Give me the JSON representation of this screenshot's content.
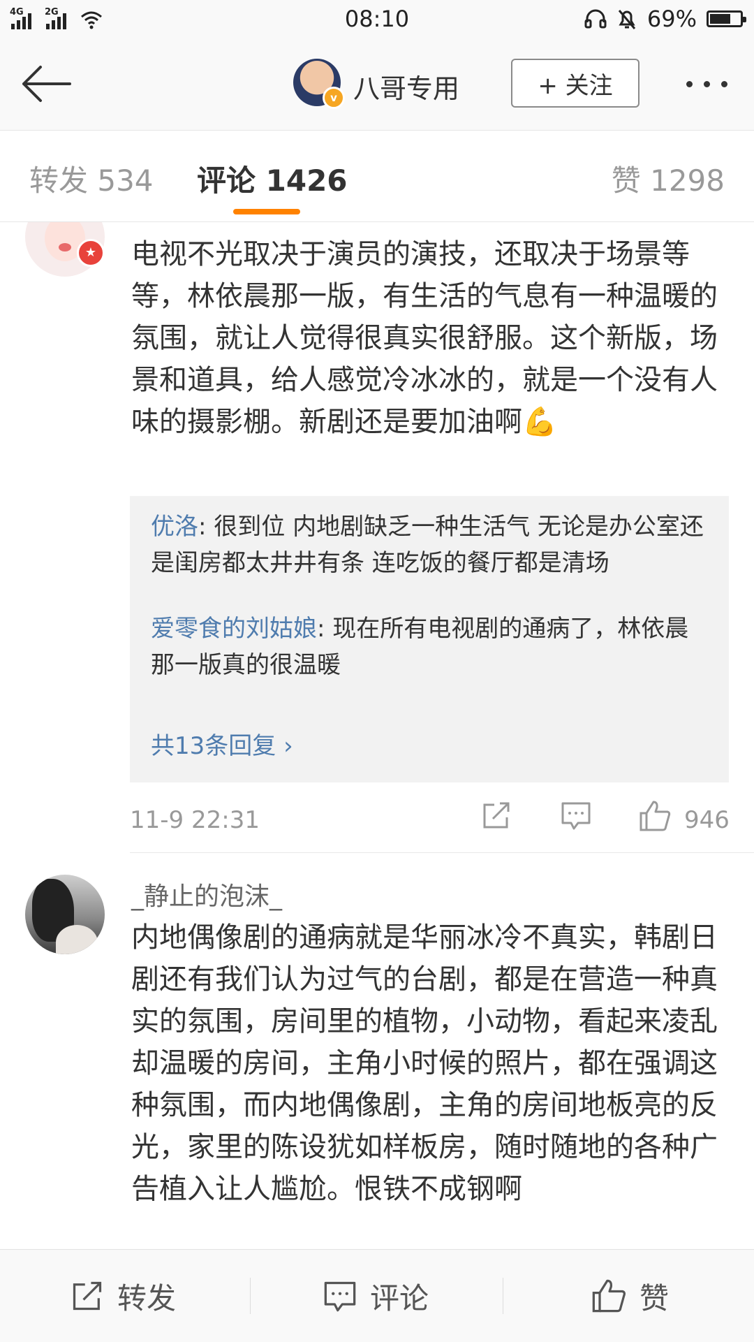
{
  "status_bar": {
    "network_1": "4G",
    "network_2": "2G",
    "time": "08:10",
    "battery_percent": "69%",
    "battery_level": 0.69
  },
  "nav": {
    "title": "八哥专用",
    "follow_label": "+ 关注",
    "icons": [
      "back-arrow-icon",
      "verified-v-icon",
      "more-dots-icon"
    ]
  },
  "tabs": {
    "repost": "转发 534",
    "comments": "评论 1426",
    "likes": "赞 1298"
  },
  "comment1": {
    "text": "电视不光取决于演员的演技，还取决于场景等等，林依晨那一版，有生活的气息有一种温暖的氛围，就让人觉得很真实很舒服。这个新版，场景和道具，给人感觉冷冰冰的，就是一个没有人味的摄影棚。新剧还是要加油啊💪",
    "replies": [
      {
        "user": "优洛",
        "text": ": 很到位 内地剧缺乏一种生活气 无论是办公室还是闺房都太井井有条 连吃饭的餐厅都是清场"
      },
      {
        "user": "爱零食的刘姑娘",
        "text": ": 现在所有电视剧的通病了，林依晨那一版真的很温暖"
      }
    ],
    "more_replies": "共13条回复 ›",
    "time": "11-9 22:31",
    "like_count": "946"
  },
  "comment2": {
    "username": "_静止的泡沫_",
    "text": "内地偶像剧的通病就是华丽冰冷不真实，韩剧日剧还有我们认为过气的台剧，都是在营造一种真实的氛围，房间里的植物，小动物，看起来凌乱却温暖的房间，主角小时候的照片，都在强调这种氛围，而内地偶像剧，主角的房间地板亮的反光，家里的陈设犹如样板房，随时随地的各种广告植入让人尴尬。恨铁不成钢啊"
  },
  "bottom_bar": {
    "repost": "转发",
    "comment": "评论",
    "like": "赞"
  },
  "colors": {
    "accent": "#ff8200",
    "link": "#4f7cae",
    "muted": "#999999"
  }
}
